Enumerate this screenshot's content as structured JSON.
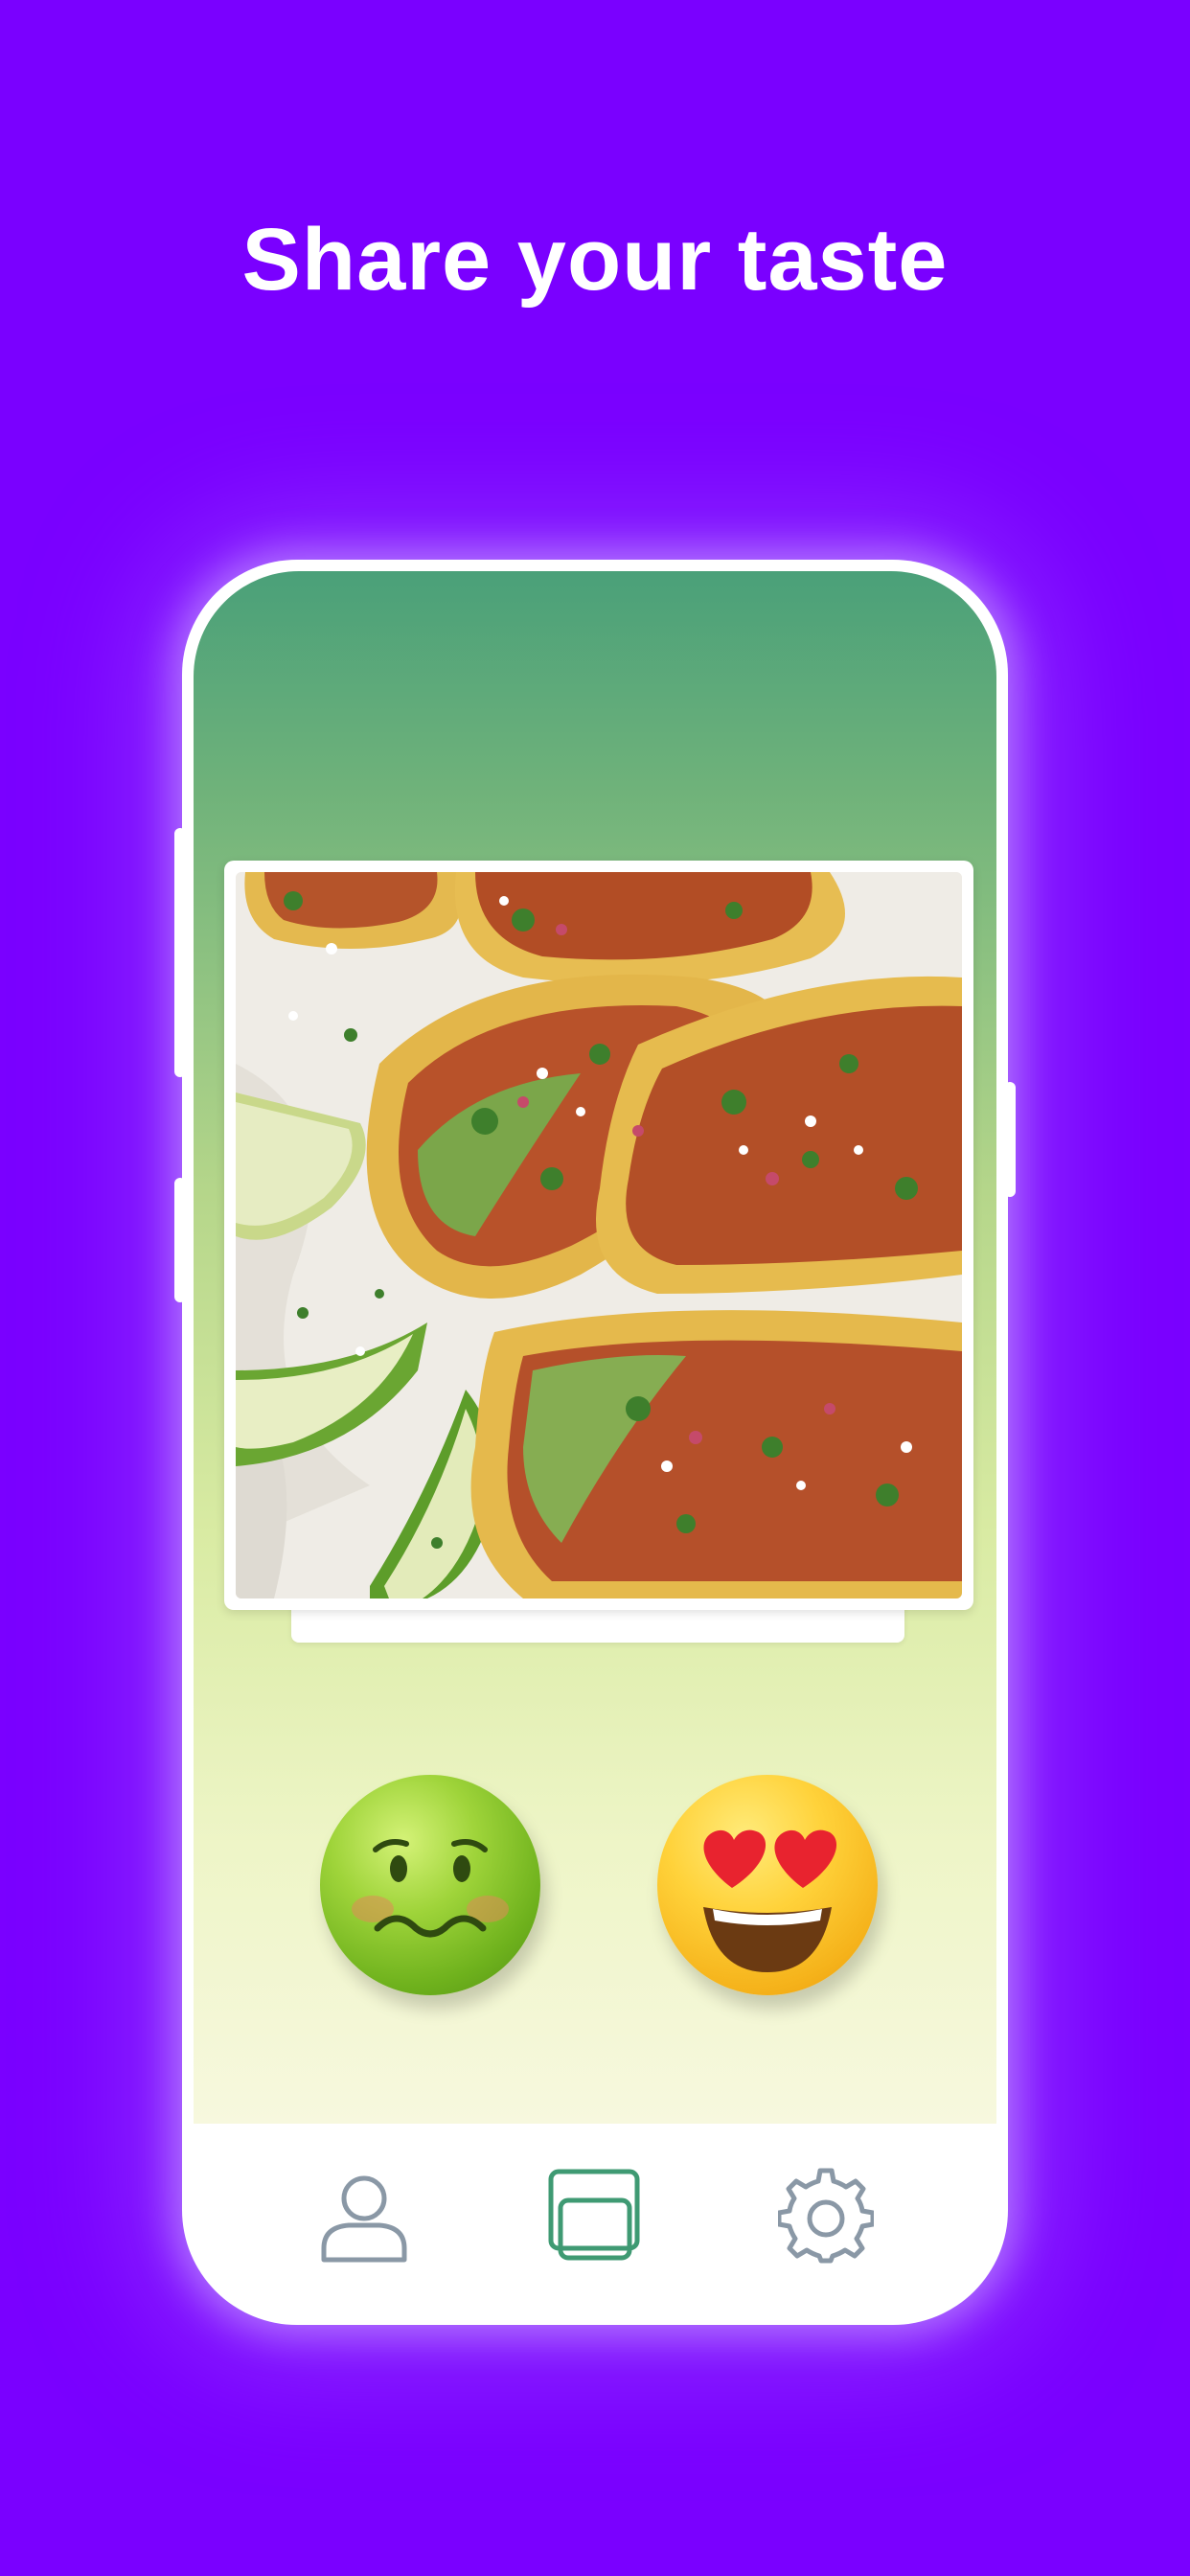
{
  "headline": "Share your taste",
  "colors": {
    "background": "#7a00ff",
    "accent_green": "#3f9a73",
    "icon_gray": "#8a98a6"
  },
  "card": {
    "image": "tacos-photo",
    "description_visible": false
  },
  "reactions": [
    {
      "name": "dislike-emoji",
      "icon": "nauseated-face"
    },
    {
      "name": "love-emoji",
      "icon": "heart-eyes-face"
    }
  ],
  "tabbar": {
    "tabs": [
      {
        "name": "profile",
        "icon": "person-icon",
        "active": false
      },
      {
        "name": "cards",
        "icon": "cards-icon",
        "active": true
      },
      {
        "name": "settings",
        "icon": "gear-icon",
        "active": false
      }
    ]
  }
}
